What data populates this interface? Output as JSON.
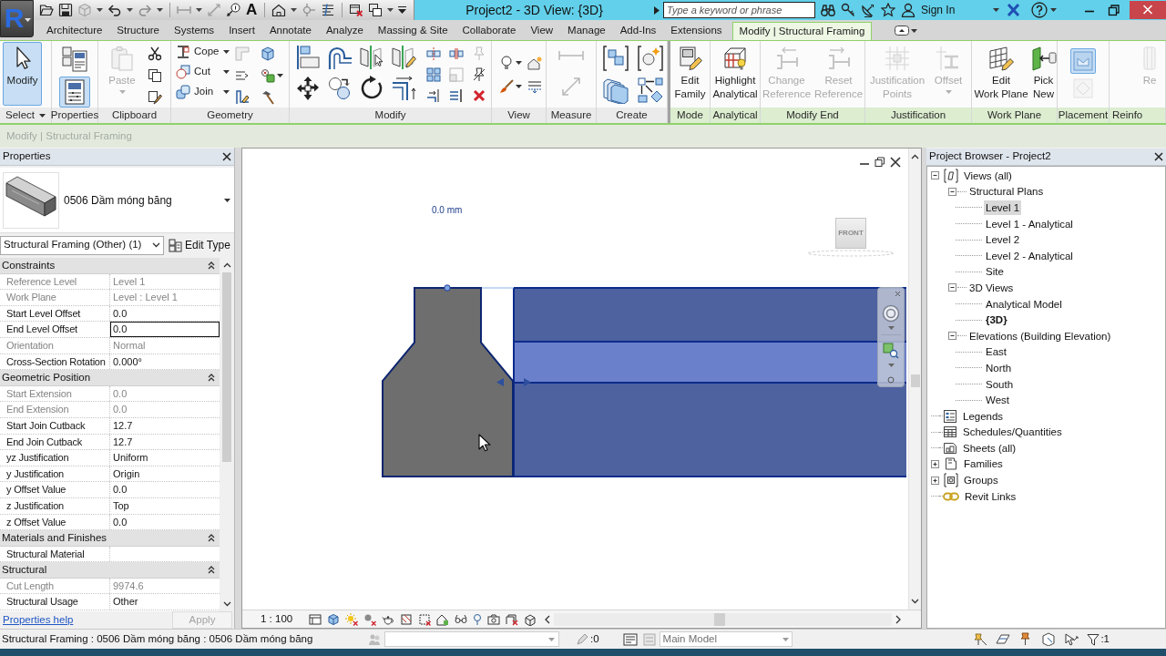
{
  "app_button": {
    "logo": "R"
  },
  "quick_access": {
    "text_tool": "A"
  },
  "title_bar": {
    "title": "Project2 - 3D View: {3D}",
    "search": {
      "placeholder": "Type a keyword or phrase"
    },
    "sign_in": "Sign In"
  },
  "ribbon_tabs": [
    {
      "label": "Architecture",
      "selected": false
    },
    {
      "label": "Structure",
      "selected": false
    },
    {
      "label": "Systems",
      "selected": false
    },
    {
      "label": "Insert",
      "selected": false
    },
    {
      "label": "Annotate",
      "selected": false
    },
    {
      "label": "Analyze",
      "selected": false
    },
    {
      "label": "Massing & Site",
      "selected": false
    },
    {
      "label": "Collaborate",
      "selected": false
    },
    {
      "label": "View",
      "selected": false
    },
    {
      "label": "Manage",
      "selected": false
    },
    {
      "label": "Add-Ins",
      "selected": false
    },
    {
      "label": "Extensions",
      "selected": false
    },
    {
      "label": "Modify | Structural Framing",
      "selected": true
    }
  ],
  "ribbon_panels": [
    {
      "kind": "select",
      "title": "Select",
      "contextual": false,
      "tools": [
        {
          "label": "Modify",
          "selected": true,
          "disabled": false
        }
      ]
    },
    {
      "kind": "properties",
      "title": "Properties",
      "contextual": false,
      "tools": [
        {
          "selected": false
        },
        {
          "selected": true
        }
      ]
    },
    {
      "kind": "clipboard",
      "title": "Clipboard",
      "contextual": false,
      "tools": [
        {
          "label": "Paste",
          "disabled": true,
          "dropdown": true
        }
      ]
    },
    {
      "kind": "geometry",
      "title": "Geometry",
      "contextual": false,
      "tools": [
        {
          "label": "Cope",
          "disabled": false,
          "dropdown": true
        },
        {
          "label": "Cut",
          "disabled": false,
          "dropdown": true
        },
        {
          "label": "Join",
          "disabled": false,
          "dropdown": true
        }
      ]
    },
    {
      "kind": "modify",
      "title": "Modify",
      "contextual": false
    },
    {
      "kind": "view",
      "title": "View",
      "contextual": false
    },
    {
      "kind": "measure",
      "title": "Measure",
      "contextual": false
    },
    {
      "kind": "create",
      "title": "Create",
      "contextual": false
    },
    {
      "kind": "mode",
      "title": "Mode",
      "contextual": true,
      "tools": [
        {
          "label": "Edit\nFamily",
          "disabled": false
        }
      ]
    },
    {
      "kind": "analytical",
      "title": "Analytical",
      "contextual": true,
      "tools": [
        {
          "label": "Highlight\nAnalytical",
          "disabled": false
        }
      ]
    },
    {
      "kind": "ends",
      "title": "Modify End",
      "contextual": true,
      "tools": [
        {
          "label": "Change\nReference",
          "disabled": true
        },
        {
          "label": "Reset\nReference",
          "disabled": true
        }
      ]
    },
    {
      "kind": "justification",
      "title": "Justification",
      "contextual": true,
      "tools": [
        {
          "label": "Justification\nPoints",
          "disabled": true
        },
        {
          "label": "Offset",
          "disabled": true,
          "dropdown": true
        }
      ]
    },
    {
      "kind": "workplane",
      "title": "Work Plane",
      "contextual": true,
      "tools": [
        {
          "label": "Edit\nWork Plane",
          "disabled": false
        },
        {
          "label": "Pick\nNew",
          "disabled": false
        }
      ]
    },
    {
      "kind": "placement",
      "title": "Placement",
      "contextual": true,
      "tools": [
        {
          "selected": true,
          "disabled": false
        },
        {
          "selected": false,
          "disabled": true
        }
      ]
    },
    {
      "kind": "reinforcement",
      "title": "Reinfo",
      "contextual": true,
      "tools": [
        {
          "label": "Re",
          "disabled": true
        }
      ]
    }
  ],
  "options_bar": {
    "label": "Modify | Structural Framing"
  },
  "properties": {
    "title": "Properties",
    "type_name": "0506 Dầm móng băng",
    "filter": "Structural Framing (Other) (1)",
    "edit_type": "Edit Type",
    "groups": [
      {
        "title": "Constraints",
        "expanded": true,
        "rows": [
          {
            "label": "Reference Level",
            "value": "Level 1",
            "disabled": true,
            "selected": false
          },
          {
            "label": "Work Plane",
            "value": "Level : Level 1",
            "disabled": true,
            "selected": false
          },
          {
            "label": "Start Level Offset",
            "value": "0.0",
            "disabled": false,
            "selected": false
          },
          {
            "label": "End Level Offset",
            "value": "0.0",
            "disabled": false,
            "selected": true
          },
          {
            "label": "Orientation",
            "value": "Normal",
            "disabled": true,
            "selected": false
          },
          {
            "label": "Cross-Section Rotation",
            "value": "0.000°",
            "disabled": false,
            "selected": false
          }
        ]
      },
      {
        "title": "Geometric Position",
        "expanded": true,
        "rows": [
          {
            "label": "Start Extension",
            "value": "0.0",
            "disabled": true,
            "selected": false
          },
          {
            "label": "End Extension",
            "value": "0.0",
            "disabled": true,
            "selected": false
          },
          {
            "label": "Start Join Cutback",
            "value": "12.7",
            "disabled": false,
            "selected": false
          },
          {
            "label": "End Join Cutback",
            "value": "12.7",
            "disabled": false,
            "selected": false
          },
          {
            "label": "yz Justification",
            "value": "Uniform",
            "disabled": false,
            "selected": false
          },
          {
            "label": "y Justification",
            "value": "Origin",
            "disabled": false,
            "selected": false
          },
          {
            "label": "y Offset Value",
            "value": "0.0",
            "disabled": false,
            "selected": false
          },
          {
            "label": "z Justification",
            "value": "Top",
            "disabled": false,
            "selected": false
          },
          {
            "label": "z Offset Value",
            "value": "0.0",
            "disabled": false,
            "selected": false
          }
        ]
      },
      {
        "title": "Materials and Finishes",
        "expanded": true,
        "rows": [
          {
            "label": "Structural Material",
            "disabled": false,
            "selected": false
          }
        ]
      },
      {
        "title": "Structural",
        "expanded": true,
        "rows": [
          {
            "label": "Cut Length",
            "value": "9974.6",
            "disabled": true,
            "selected": false
          },
          {
            "label": "Structural Usage",
            "value": "Other",
            "disabled": false,
            "selected": false
          }
        ]
      }
    ],
    "help_link": "Properties help",
    "apply": {
      "label": "Apply",
      "disabled": true
    }
  },
  "viewport": {
    "dimension_label": "0.0 mm",
    "view_cube": "FRONT",
    "scale": "1 : 100"
  },
  "project_browser": {
    "title": "Project Browser - Project2",
    "items": [
      {
        "label": "Views (all)",
        "kind": "views",
        "expanded": true,
        "selected": false,
        "children": [
          {
            "label": "Structural Plans",
            "expanded": true,
            "selected": false,
            "children": [
              {
                "label": "Level 1",
                "selected": true,
                "current": false
              },
              {
                "label": "Level 1 - Analytical",
                "selected": false,
                "current": false
              },
              {
                "label": "Level 2",
                "selected": false,
                "current": false
              },
              {
                "label": "Level 2 - Analytical",
                "selected": false,
                "current": false
              },
              {
                "label": "Site",
                "selected": false,
                "current": false
              }
            ]
          },
          {
            "label": "3D Views",
            "expanded": true,
            "selected": false,
            "children": [
              {
                "label": "Analytical Model",
                "selected": false,
                "current": false
              },
              {
                "label": "{3D}",
                "selected": false,
                "current": true
              }
            ]
          },
          {
            "label": "Elevations (Building Elevation)",
            "expanded": true,
            "selected": false,
            "children": [
              {
                "label": "East",
                "selected": false,
                "current": false
              },
              {
                "label": "North",
                "selected": false,
                "current": false
              },
              {
                "label": "South",
                "selected": false,
                "current": false
              },
              {
                "label": "West",
                "selected": false,
                "current": false
              }
            ]
          }
        ]
      },
      {
        "label": "Legends",
        "kind": "legends",
        "selected": false
      },
      {
        "label": "Schedules/Quantities",
        "kind": "schedules",
        "selected": false
      },
      {
        "label": "Sheets (all)",
        "kind": "sheets",
        "selected": false
      },
      {
        "label": "Families",
        "kind": "families",
        "expanded": false,
        "selected": false
      },
      {
        "label": "Groups",
        "kind": "groups",
        "expanded": false,
        "selected": false
      },
      {
        "label": "Revit Links",
        "kind": "links",
        "selected": false
      }
    ]
  },
  "status_bar": {
    "message": "Structural Framing : 0506 Dầm móng băng : 0506 Dầm móng băng",
    "editable_count": ":0",
    "design_option": {
      "value": "Main Model",
      "disabled": true
    },
    "filter_count": ":1"
  }
}
